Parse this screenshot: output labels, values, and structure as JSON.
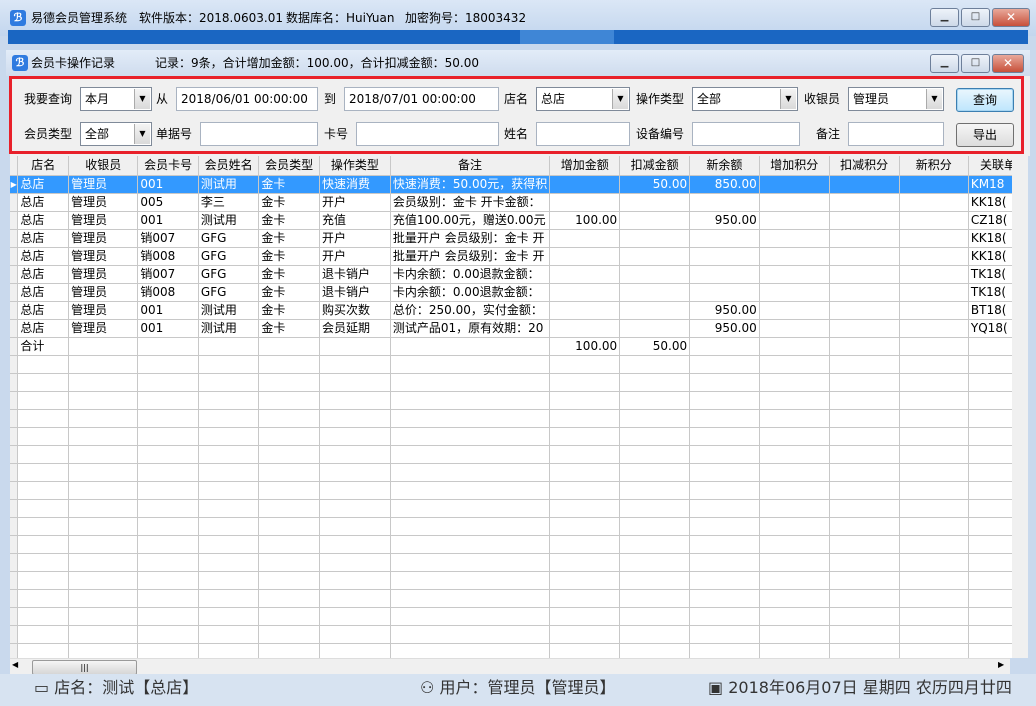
{
  "outer_window": {
    "app_name": "易德会员管理系统",
    "version_text": "软件版本：2018.0603.01",
    "db_text": "数据库名：HuiYuan",
    "dongle_text": "加密狗号：18003432"
  },
  "inner_window": {
    "title": "会员卡操作记录",
    "summary": "记录：9条，合计增加金额：100.00，合计扣减金额：50.00"
  },
  "filters": {
    "query_label": "我要查询",
    "query_value": "本月",
    "from_label": "从",
    "from_value": "2018/06/01 00:00:00",
    "to_label": "到",
    "to_value": "2018/07/01 00:00:00",
    "store_label": "店名",
    "store_value": "总店",
    "optype_label": "操作类型",
    "optype_value": "全部",
    "cashier_label": "收银员",
    "cashier_value": "管理员",
    "query_button": "查询",
    "member_type_label": "会员类型",
    "member_type_value": "全部",
    "doc_no_label": "单据号",
    "card_no_label": "卡号",
    "name_label": "姓名",
    "device_label": "设备编号",
    "remark_label": "备注",
    "export_button": "导出"
  },
  "table": {
    "columns": [
      "店名",
      "收银员",
      "会员卡号",
      "会员姓名",
      "会员类型",
      "操作类型",
      "备注",
      "增加金额",
      "扣减金额",
      "新余额",
      "增加积分",
      "扣减积分",
      "新积分",
      "关联单"
    ],
    "rows": [
      [
        "总店",
        "管理员",
        "001",
        "测试用",
        "金卡",
        "快速消费",
        "快速消费：50.00元，获得积",
        "",
        "50.00",
        "850.00",
        "",
        "",
        "",
        "KM18"
      ],
      [
        "总店",
        "管理员",
        "005",
        "李三",
        "金卡",
        "开户",
        "会员级别：金卡 开卡金额：",
        "",
        "",
        "",
        "",
        "",
        "",
        "KK18("
      ],
      [
        "总店",
        "管理员",
        "001",
        "测试用",
        "金卡",
        "充值",
        "充值100.00元，赠送0.00元",
        "100.00",
        "",
        "950.00",
        "",
        "",
        "",
        "CZ18("
      ],
      [
        "总店",
        "管理员",
        "销007",
        "GFG",
        "金卡",
        "开户",
        "批量开户  会员级别：金卡 开",
        "",
        "",
        "",
        "",
        "",
        "",
        "KK18("
      ],
      [
        "总店",
        "管理员",
        "销008",
        "GFG",
        "金卡",
        "开户",
        "批量开户  会员级别：金卡 开",
        "",
        "",
        "",
        "",
        "",
        "",
        "KK18("
      ],
      [
        "总店",
        "管理员",
        "销007",
        "GFG",
        "金卡",
        "退卡销户",
        "卡内余额：0.00退款金额：",
        "",
        "",
        "",
        "",
        "",
        "",
        "TK18("
      ],
      [
        "总店",
        "管理员",
        "销008",
        "GFG",
        "金卡",
        "退卡销户",
        "卡内余额：0.00退款金额：",
        "",
        "",
        "",
        "",
        "",
        "",
        "TK18("
      ],
      [
        "总店",
        "管理员",
        "001",
        "测试用",
        "金卡",
        "购买次数",
        "总价：250.00，实付金额：",
        "",
        "",
        "950.00",
        "",
        "",
        "",
        "BT18("
      ],
      [
        "总店",
        "管理员",
        "001",
        "测试用",
        "金卡",
        "会员延期",
        "测试产品01，原有效期：20",
        "",
        "",
        "950.00",
        "",
        "",
        "",
        "YQ18("
      ]
    ],
    "total_row": [
      "合计",
      "",
      "",
      "",
      "",
      "",
      "",
      "100.00",
      "50.00",
      "",
      "",
      "",
      "",
      ""
    ]
  },
  "status_bar": {
    "store": "店名：测试【总店】",
    "user": "用户：管理员【管理员】",
    "date": "2018年06月07日 星期四 农历四月廿四"
  },
  "colors": {
    "accent": "#3399ff",
    "highlight_border": "#e8202a",
    "title_bar": "#1a66c2"
  }
}
